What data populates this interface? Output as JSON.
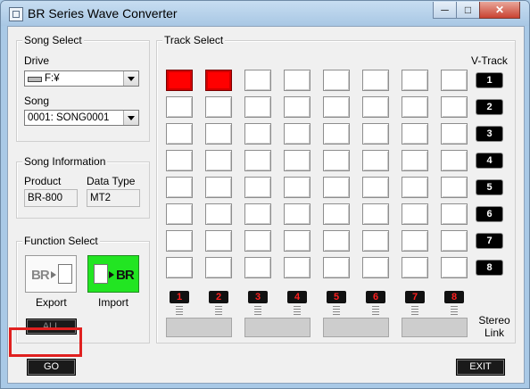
{
  "window": {
    "title": "BR Series Wave Converter",
    "buttons": {
      "minimize": "─",
      "maximize": "□",
      "close": "✕"
    }
  },
  "song_select": {
    "title": "Song Select",
    "drive_label": "Drive",
    "drive_value": "F:¥",
    "song_label": "Song",
    "song_value": "0001: SONG0001"
  },
  "song_info": {
    "title": "Song Information",
    "product_label": "Product",
    "product_value": "BR-800",
    "datatype_label": "Data Type",
    "datatype_value": "MT2"
  },
  "function_select": {
    "title": "Function Select",
    "export_icon_text": "BR",
    "import_icon_text": "BR",
    "export_label": "Export",
    "import_label": "Import",
    "all_label": "ALL"
  },
  "track_select": {
    "title": "Track Select",
    "vtrack_label": "V-Track",
    "vtracks": [
      "1",
      "2",
      "3",
      "4",
      "5",
      "6",
      "7",
      "8"
    ],
    "tracks": [
      "1",
      "2",
      "3",
      "4",
      "5",
      "6",
      "7",
      "8"
    ],
    "selected": [
      [
        1,
        1
      ],
      [
        1,
        2
      ]
    ],
    "stereo_link_label": "Stereo\nLink"
  },
  "actions": {
    "go_label": "GO",
    "exit_label": "EXIT"
  },
  "colors": {
    "selected_cell": "#ff0000",
    "import_button": "#22e522",
    "highlight": "#e0201f"
  }
}
